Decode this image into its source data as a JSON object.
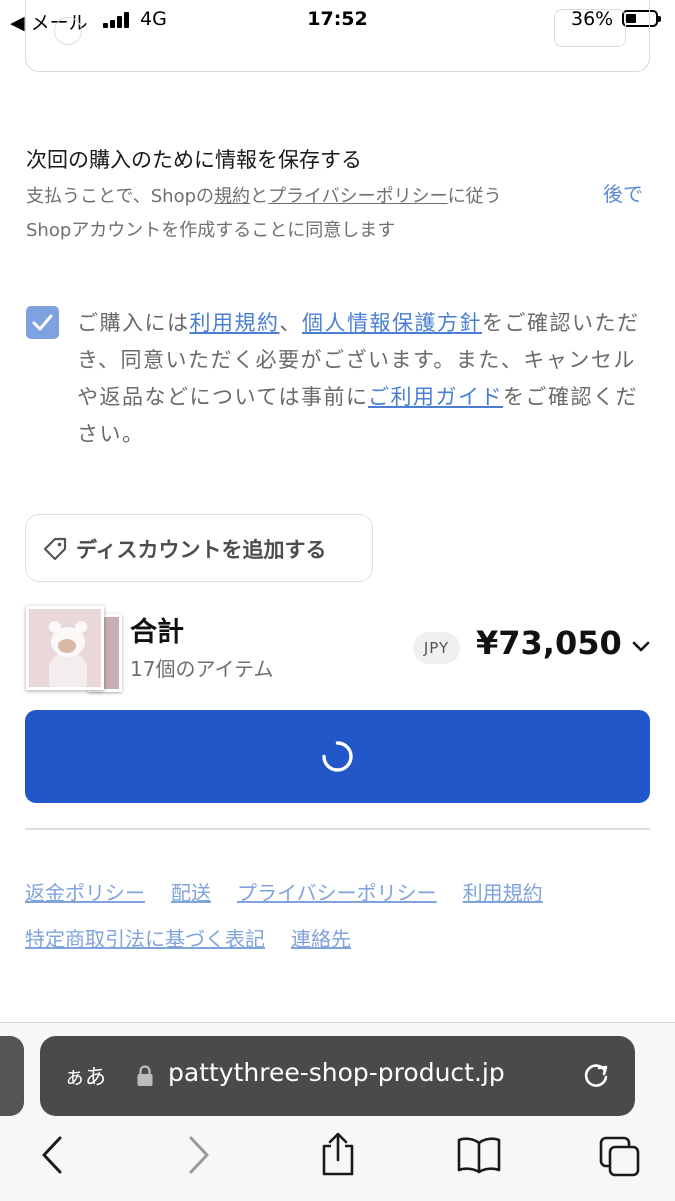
{
  "status_bar": {
    "back_label": "◀ メール",
    "network": "4G",
    "time": "17:52",
    "battery_percent": "36%"
  },
  "save_info": {
    "title": "次回の購入のために情報を保存する",
    "desc_1": "支払うことで、Shopの",
    "desc_terms_link": "規約",
    "desc_2": "と",
    "desc_privacy_link": "プライバシーポリシー",
    "desc_3": "に従う",
    "desc_line2": "Shopアカウントを作成することに同意します",
    "later_label": "後で"
  },
  "consent": {
    "checked": true,
    "text_1": "ご購入には",
    "link_terms": "利用規約",
    "text_2": "、",
    "link_privacy": "個人情報保護方針",
    "text_3": "をご確認いただき、同意いただく必要がございます。また、キャンセルや返品などについては事前に",
    "link_guide": "ご利用ガイド",
    "text_4": "をご確認ください。"
  },
  "discount": {
    "label": "ディスカウントを追加する",
    "icon": "tag-icon"
  },
  "summary": {
    "total_label": "合計",
    "item_count": "17個のアイテム",
    "currency": "JPY",
    "amount": "¥73,050"
  },
  "pay_button": {
    "state": "loading",
    "color": "#2157c8"
  },
  "footer": {
    "links": [
      "返金ポリシー",
      "配送",
      "プライバシーポリシー",
      "利用規約",
      "特定商取引法に基づく表記",
      "連絡先"
    ]
  },
  "browser": {
    "aa_label": "ぁあ",
    "url": "pattythree-shop-product.jp"
  },
  "colors": {
    "accent": "#2157c8",
    "link": "#4a7fd4",
    "checkbox": "#7ea2e0"
  }
}
